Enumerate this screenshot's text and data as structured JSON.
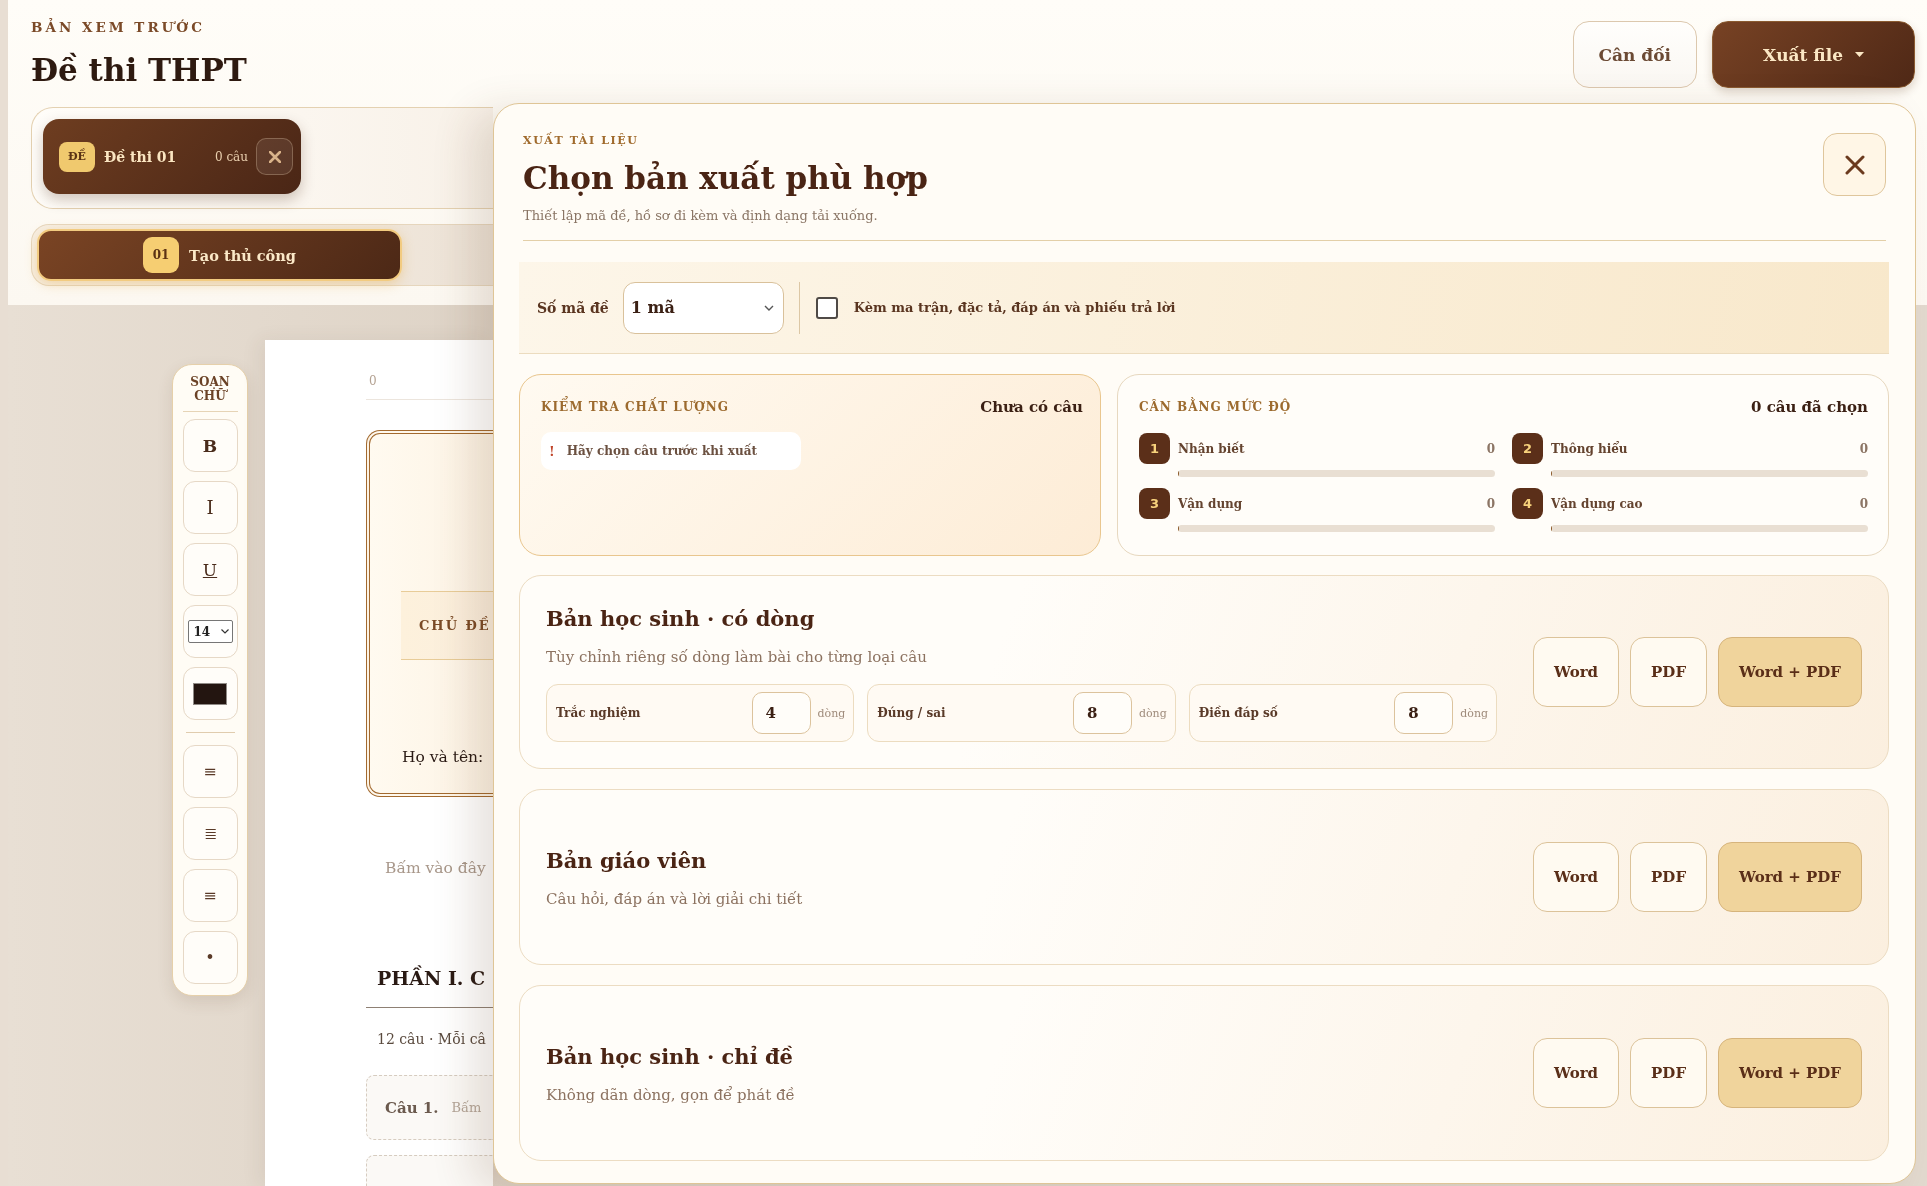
{
  "header": {
    "eyebrow": "BẢN XEM TRƯỚC",
    "title": "Đề thi THPT",
    "actions": [
      {
        "label": "Cân đối",
        "kind": "secondary",
        "menu": false
      },
      {
        "label": "Xuất file",
        "kind": "primary",
        "menu": true
      }
    ]
  },
  "tabs": [
    {
      "badge": "ĐỀ",
      "label": "Đề thi 01",
      "count": "0 câu",
      "selected": true
    }
  ],
  "creation_modes": [
    {
      "badge": "01",
      "label": "Tạo thủ công",
      "selected": true
    }
  ],
  "toolbar": {
    "title": "SOẠN CHỮ",
    "groups": [
      [
        {
          "kind": "bold",
          "label": "B"
        },
        {
          "kind": "italic",
          "label": "I"
        },
        {
          "kind": "underline",
          "label": "U"
        },
        {
          "kind": "size",
          "value": "14"
        },
        {
          "kind": "color",
          "color": "#231510"
        }
      ],
      [
        {
          "kind": "glyph",
          "label": "≡"
        },
        {
          "kind": "glyph",
          "label": "≣"
        },
        {
          "kind": "glyph",
          "label": "≡"
        },
        {
          "kind": "glyph",
          "label": "•"
        }
      ]
    ]
  },
  "document": {
    "page_number": "0",
    "cover": {
      "topic": "CHỦ ĐỀ",
      "name_label": "Họ và tên:"
    },
    "hint": "Bấm vào đây",
    "section": {
      "title": "PHẦN I. C",
      "note": "12 câu · Mỗi câ"
    },
    "questions": [
      {
        "label": "Câu 1.",
        "hint": "Bấm"
      }
    ]
  },
  "export_dialog": {
    "eyebrow": "XUẤT TÀI LIỆU",
    "title": "Chọn bản xuất phù hợp",
    "subtitle": "Thiết lập mã đề, hồ sơ đi kèm và định dạng tải xuống.",
    "options": {
      "code_count": {
        "label": "Số mã đề",
        "value": "1 mã"
      },
      "attachments": {
        "label": "Kèm ma trận, đặc tả, đáp án và phiếu trả lời",
        "checked": false
      }
    },
    "quality": {
      "title": "KIỂM TRA CHẤT LƯỢNG",
      "status": "Chưa có câu",
      "warnings": [
        {
          "mark": "!",
          "text": "Hãy chọn câu trước khi xuất"
        }
      ]
    },
    "balance": {
      "title": "CÂN BẰNG MỨC ĐỘ",
      "summary": "0 câu đã chọn",
      "levels": [
        {
          "number": "1",
          "name": "Nhận biết",
          "count": "0",
          "level": 0
        },
        {
          "number": "2",
          "name": "Thông hiểu",
          "count": "0",
          "level": 0
        },
        {
          "number": "3",
          "name": "Vận dụng",
          "count": "0",
          "level": 0
        },
        {
          "number": "4",
          "name": "Vận dụng cao",
          "count": "0",
          "level": 0
        }
      ]
    },
    "variants": [
      {
        "title": "Bản học sinh · có dòng",
        "description": "Tùy chỉnh riêng số dòng làm bài cho từng loại câu",
        "line_settings": [
          {
            "label": "Trắc nghiệm",
            "value": "4",
            "unit": "dòng"
          },
          {
            "label": "Đúng / sai",
            "value": "8",
            "unit": "dòng"
          },
          {
            "label": "Điền đáp số",
            "value": "8",
            "unit": "dòng"
          }
        ],
        "formats": [
          {
            "label": "Word",
            "primary": false
          },
          {
            "label": "PDF",
            "primary": false
          },
          {
            "label": "Word + PDF",
            "primary": true
          }
        ]
      },
      {
        "title": "Bản giáo viên",
        "description": "Câu hỏi, đáp án và lời giải chi tiết",
        "formats": [
          {
            "label": "Word",
            "primary": false
          },
          {
            "label": "PDF",
            "primary": false
          },
          {
            "label": "Word + PDF",
            "primary": true
          }
        ]
      },
      {
        "title": "Bản học sinh · chỉ đề",
        "description": "Không dãn dòng, gọn để phát đề",
        "formats": [
          {
            "label": "Word",
            "primary": false
          },
          {
            "label": "PDF",
            "primary": false
          },
          {
            "label": "Word + PDF",
            "primary": true
          }
        ]
      }
    ]
  }
}
